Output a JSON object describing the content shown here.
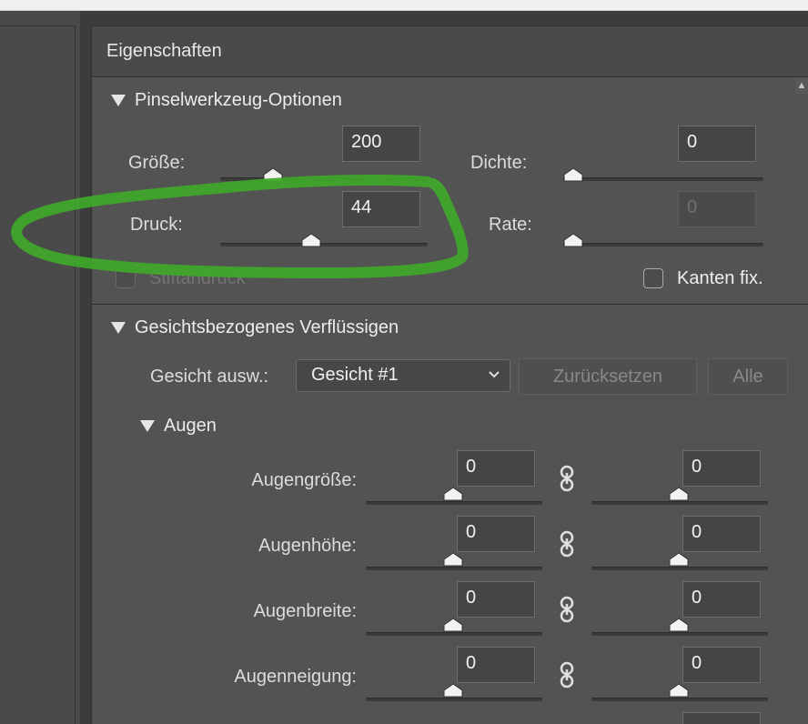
{
  "panel": {
    "title": "Eigenschaften"
  },
  "brush": {
    "section_title": "Pinselwerkzeug-Optionen",
    "size": {
      "label": "Größe:",
      "value": "200",
      "level": 0.25
    },
    "density": {
      "label": "Dichte:",
      "value": "0",
      "level": 0.0
    },
    "pressure": {
      "label": "Druck:",
      "value": "44",
      "level": 0.44
    },
    "rate": {
      "label": "Rate:",
      "value": "0",
      "level": 0.0
    },
    "stylus_pressure": {
      "label": "Stiftandruck",
      "checked": false,
      "enabled": false
    },
    "pin_edges": {
      "label": "Kanten fix.",
      "checked": false,
      "enabled": true
    }
  },
  "face": {
    "section_title": "Gesichtsbezogenes Verflüssigen",
    "select_label": "Gesicht ausw.:",
    "select_value": "Gesicht #1",
    "reset_label": "Zurücksetzen",
    "all_label": "Alle",
    "eyes": {
      "title": "Augen",
      "rows": [
        {
          "label": "Augengröße:",
          "left": "0",
          "right": "0"
        },
        {
          "label": "Augenhöhe:",
          "left": "0",
          "right": "0"
        },
        {
          "label": "Augenbreite:",
          "left": "0",
          "right": "0"
        },
        {
          "label": "Augenneigung:",
          "left": "0",
          "right": "0"
        }
      ]
    }
  },
  "colors": {
    "annotation": "#3fa82a",
    "panel_bg": "#535353"
  }
}
